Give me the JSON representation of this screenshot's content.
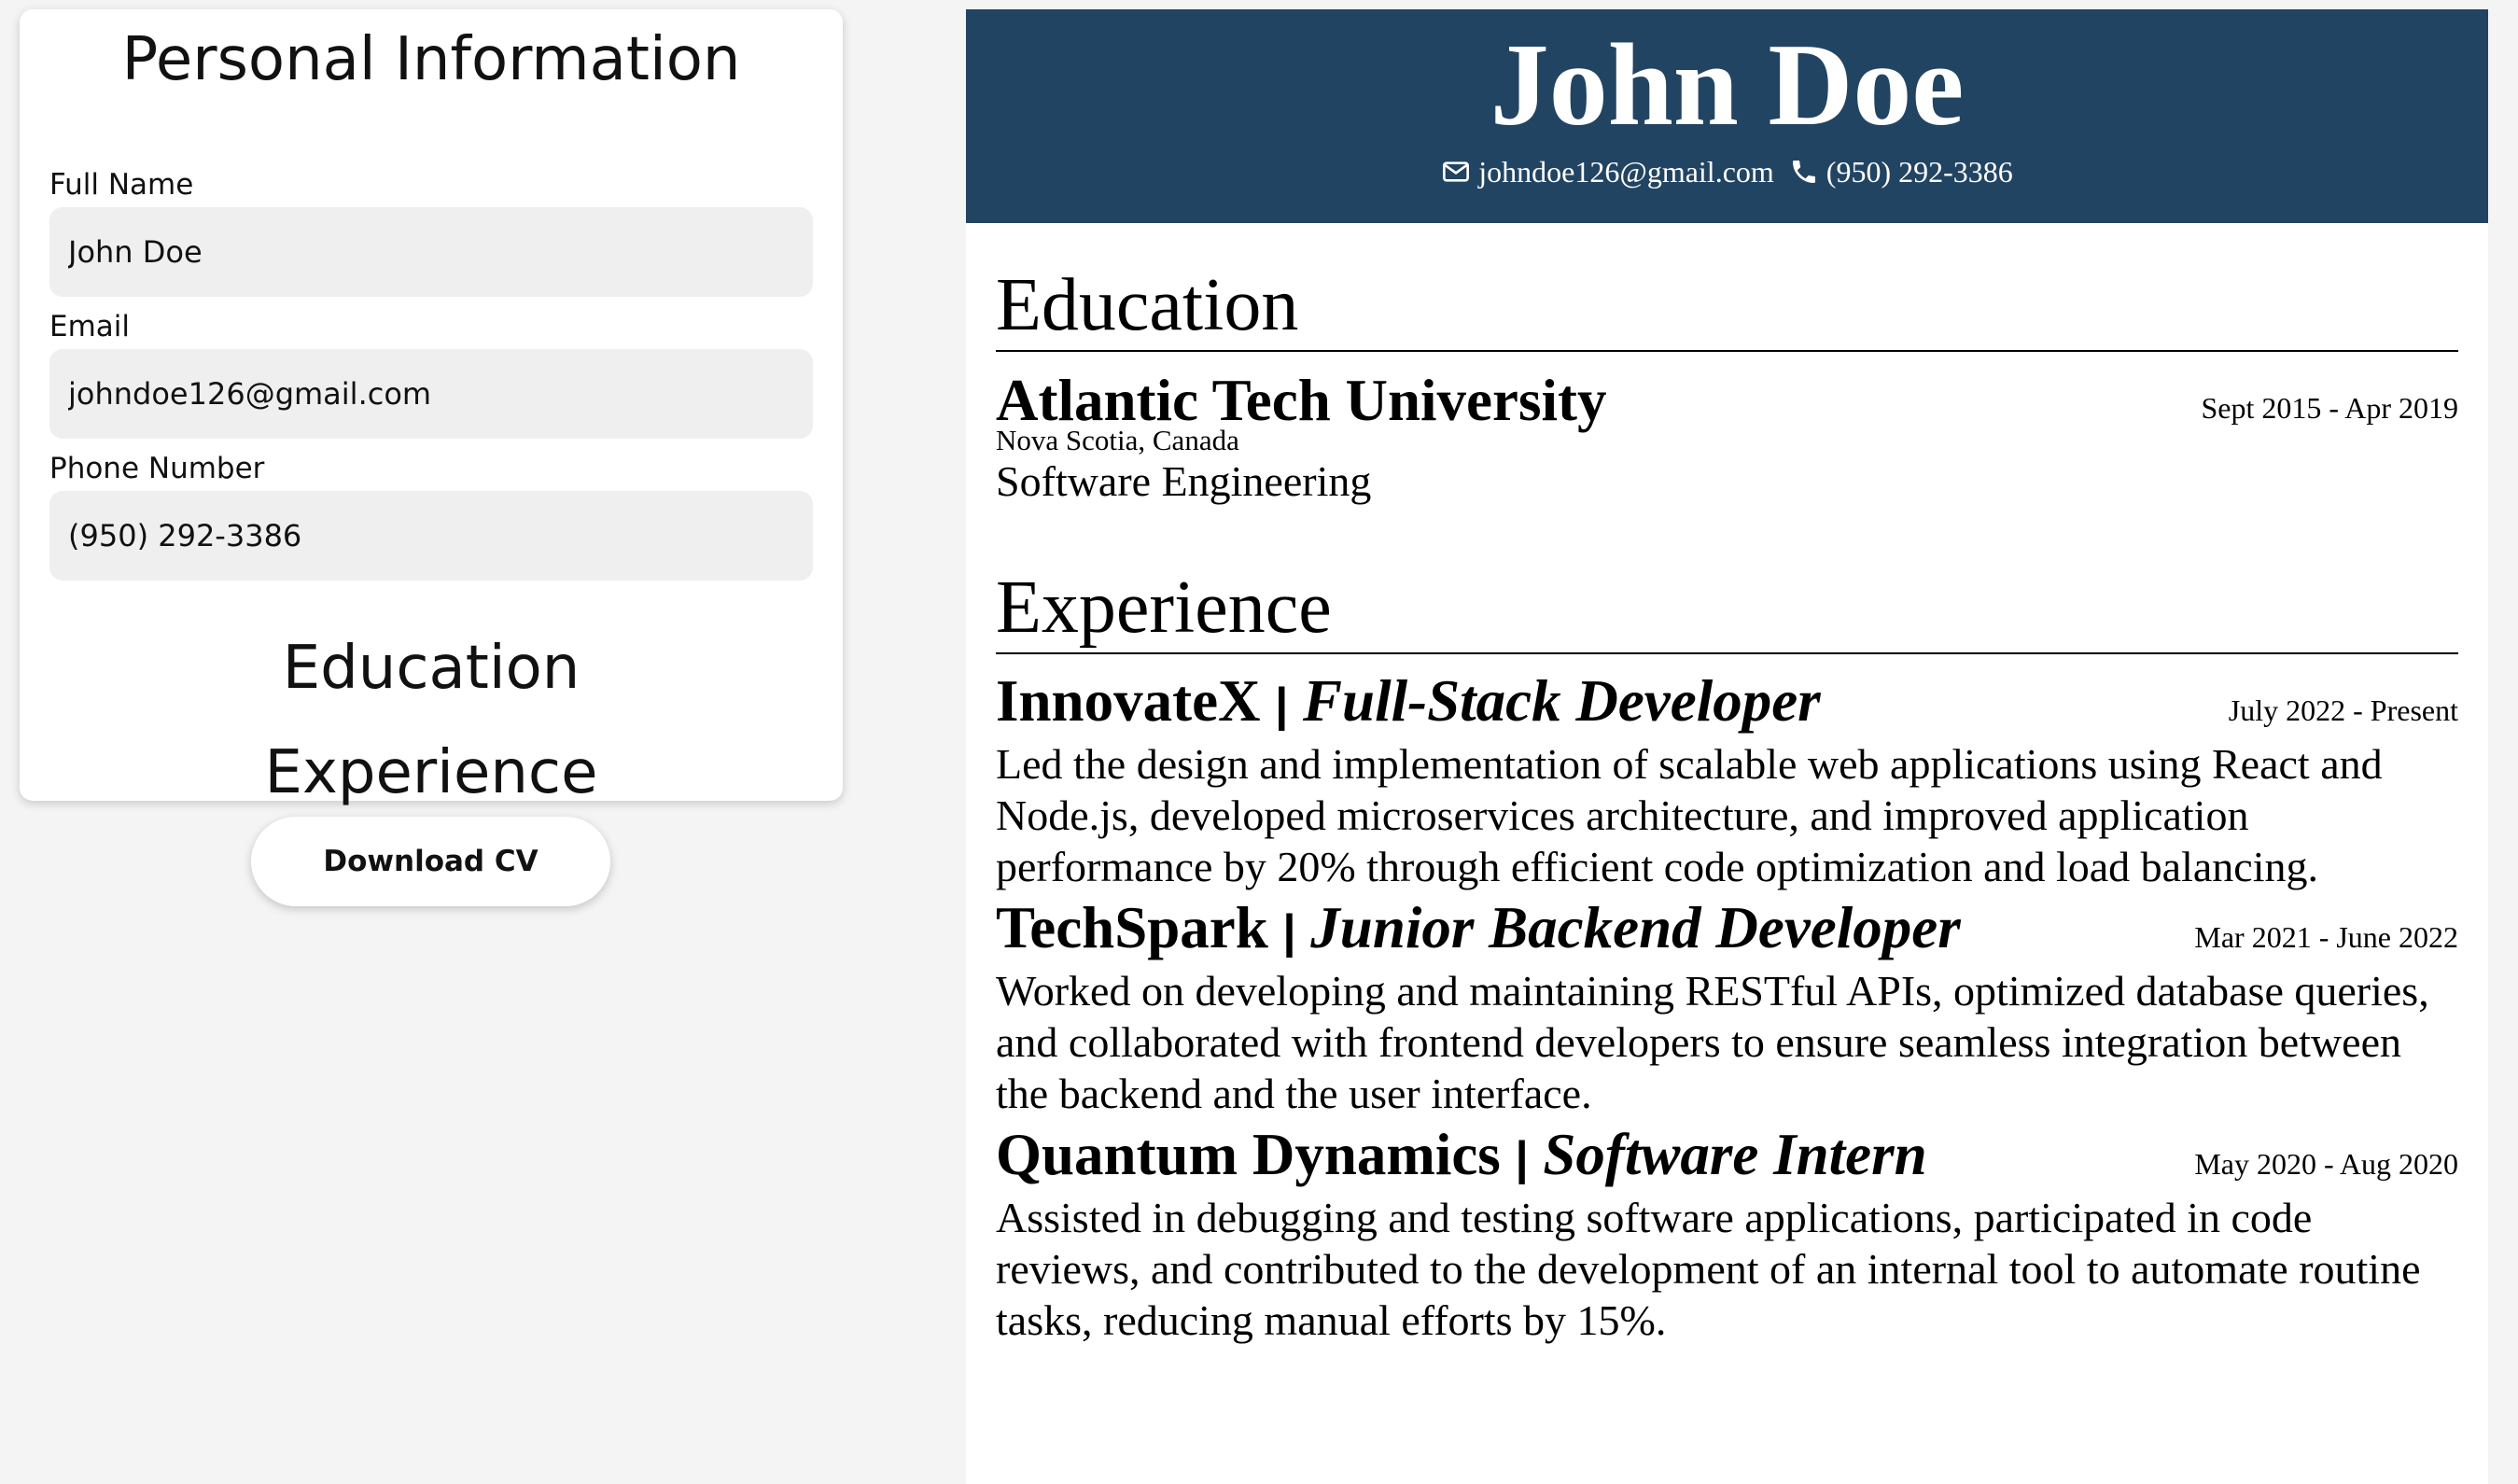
{
  "form": {
    "title": "Personal Information",
    "fields": [
      {
        "label": "Full Name",
        "value": "John Doe"
      },
      {
        "label": "Email",
        "value": "johndoe126@gmail.com"
      },
      {
        "label": "Phone Number",
        "value": "(950) 292-3386"
      }
    ],
    "sections": [
      "Education",
      "Experience"
    ],
    "download_label": "Download CV"
  },
  "cv": {
    "name": "John Doe",
    "email": "johndoe126@gmail.com",
    "phone": "(950) 292-3386",
    "header_color": "#224463",
    "education_title": "Education",
    "education": [
      {
        "school": "Atlantic Tech University",
        "dates": "Sept 2015 - Apr 2019",
        "location": "Nova Scotia, Canada",
        "degree": "Software Engineering"
      }
    ],
    "experience_title": "Experience",
    "experience": [
      {
        "company": "InnovateX",
        "separator": "|",
        "role": "Full-Stack Developer",
        "dates": "July 2022 - Present",
        "description": "Led the design and implementation of scalable web applications using React and Node.js, developed microservices architecture, and improved application performance by 20% through efficient code optimization and load balancing."
      },
      {
        "company": "TechSpark",
        "separator": "|",
        "role": "Junior Backend Developer",
        "dates": "Mar 2021 - June 2022",
        "description": "Worked on developing and maintaining RESTful APIs, optimized database queries, and collaborated with frontend developers to ensure seamless integration between the backend and the user interface."
      },
      {
        "company": "Quantum Dynamics",
        "separator": "|",
        "role": "Software Intern",
        "dates": "May 2020 - Aug 2020",
        "description": "Assisted in debugging and testing software applications, participated in code reviews, and contributed to the development of an internal tool to automate routine tasks, reducing manual efforts by 15%."
      }
    ]
  }
}
